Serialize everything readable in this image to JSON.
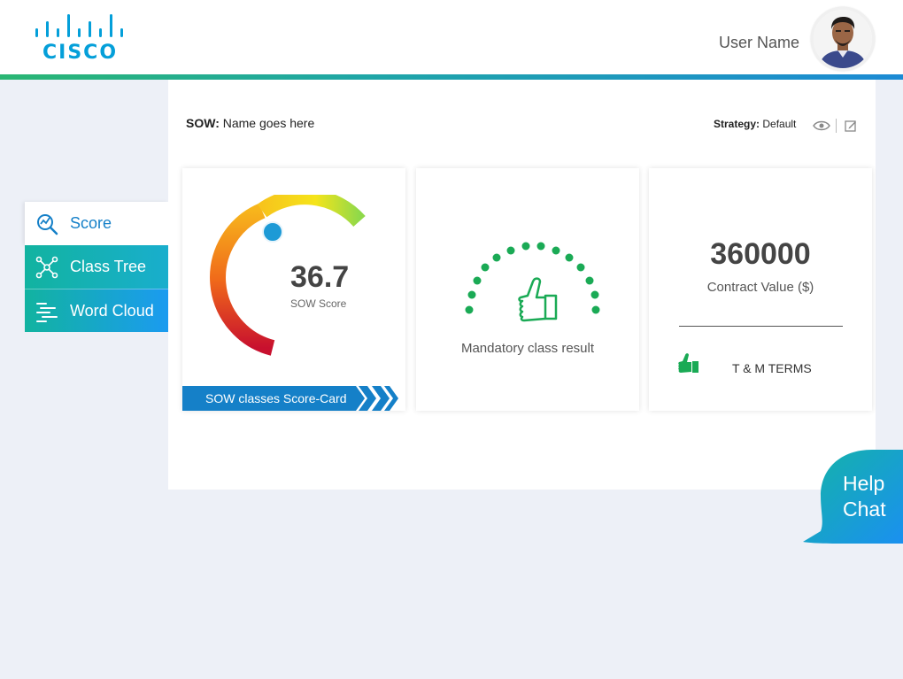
{
  "header": {
    "logo_text": "CISCO",
    "user_name": "User Name"
  },
  "sow": {
    "label": "SOW:",
    "name": "Name goes here",
    "strategy_label": "Strategy:",
    "strategy_value": "Default"
  },
  "score_card": {
    "value": "36.7",
    "label": "SOW Score",
    "button_label": "SOW classes Score-Card"
  },
  "mandatory_card": {
    "label": "Mandatory class result"
  },
  "contract_card": {
    "value": "360000",
    "label": "Contract Value ($)",
    "terms": "T & M TERMS"
  },
  "nav": {
    "items": [
      {
        "label": "Score",
        "icon": "score-icon",
        "active": true
      },
      {
        "label": "Class Tree",
        "icon": "class-tree-icon",
        "active": false
      },
      {
        "label": "Word Cloud",
        "icon": "word-cloud-icon",
        "active": false
      }
    ]
  },
  "help_chat": {
    "line1": "Help",
    "line2": "Chat"
  },
  "colors": {
    "brand_blue": "#049fd9",
    "accent_green": "#1aaa55",
    "nav_teal": "#12b3a0",
    "button_blue": "#1580c8"
  }
}
